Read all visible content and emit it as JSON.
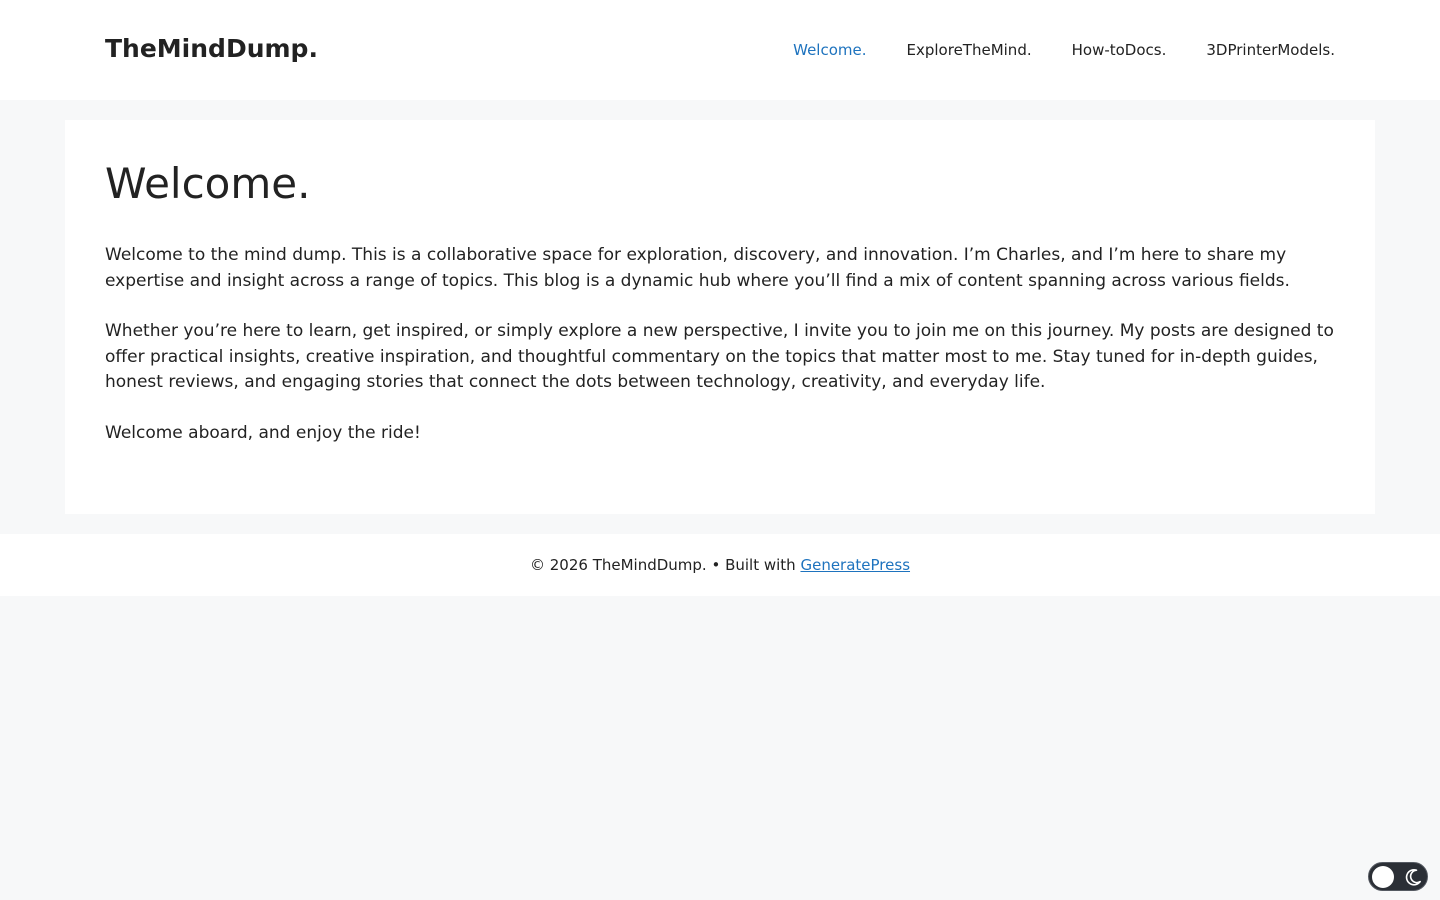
{
  "header": {
    "site_title": "TheMindDump.",
    "nav": [
      {
        "label": "Welcome.",
        "active": true
      },
      {
        "label": "ExploreTheMind.",
        "active": false
      },
      {
        "label": "How-toDocs.",
        "active": false
      },
      {
        "label": "3DPrinterModels.",
        "active": false
      }
    ]
  },
  "main": {
    "title": "Welcome.",
    "paragraphs": [
      "Welcome to the mind dump. This is a collaborative space for exploration, discovery, and innovation. I’m Charles, and I’m here to share my expertise and insight across a range of topics. This blog is a dynamic hub where you’ll find a mix of content spanning across various fields.",
      "Whether you’re here to learn, get inspired, or simply explore a new perspective, I invite you to join me on this journey. My posts are designed to offer practical insights, creative inspiration, and thoughtful commentary on the topics that matter most to me. Stay tuned for in-depth guides, honest reviews, and engaging stories that connect the dots between technology, creativity, and everyday life.",
      "Welcome aboard, and enjoy the ride!"
    ]
  },
  "footer": {
    "copyright": "© 2026 TheMindDump. • Built with ",
    "link_label": "GeneratePress"
  },
  "theme_toggle": {
    "icon": "moon-icon",
    "mode": "light"
  },
  "colors": {
    "accent": "#1e73be",
    "page_background": "#f7f8f9",
    "text": "#222222"
  }
}
